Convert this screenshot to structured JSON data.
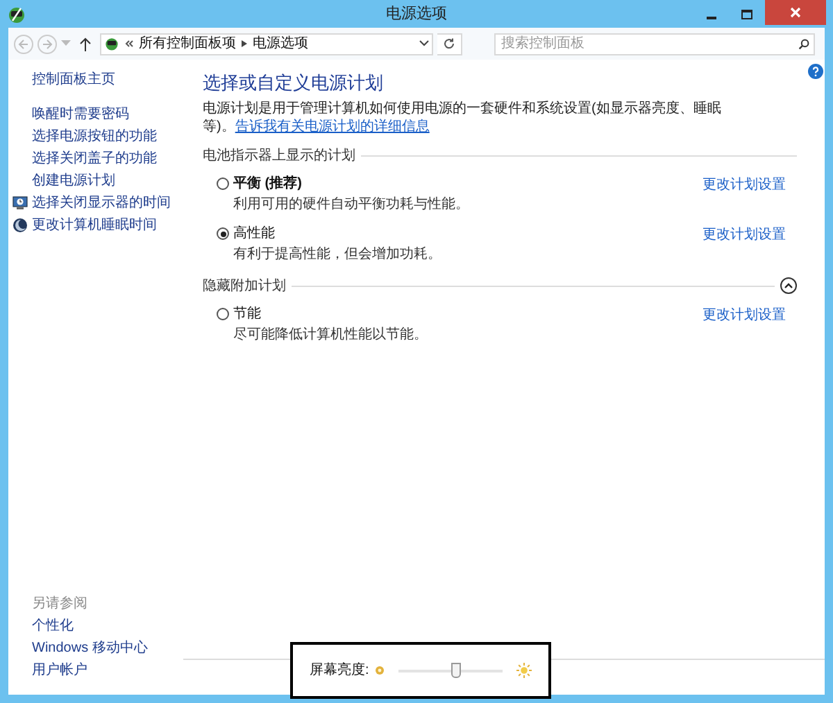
{
  "window": {
    "title": "电源选项"
  },
  "nav": {
    "back_disabled": true,
    "forward_disabled": true,
    "breadcrumb": [
      "所有控制面板项",
      "电源选项"
    ],
    "search": {
      "placeholder": "搜索控制面板"
    }
  },
  "sidebar": {
    "home": "控制面板主页",
    "tasks": [
      {
        "label": "唤醒时需要密码",
        "kind": "plain"
      },
      {
        "label": "选择电源按钮的功能",
        "kind": "plain"
      },
      {
        "label": "选择关闭盖子的功能",
        "kind": "plain"
      },
      {
        "label": "创建电源计划",
        "kind": "plain"
      },
      {
        "label": "选择关闭显示器的时间",
        "kind": "display"
      },
      {
        "label": "更改计算机睡眠时间",
        "kind": "sleep"
      }
    ],
    "see_also": {
      "heading": "另请参阅",
      "items": [
        "个性化",
        "Windows 移动中心",
        "用户帐户"
      ]
    }
  },
  "main": {
    "title": "选择或自定义电源计划",
    "description": "电源计划是用于管理计算机如何使用电源的一套硬件和系统设置(如显示器亮度、睡眠等)。",
    "description_link": "告诉我有关电源计划的详细信息",
    "sections": [
      {
        "heading": "电池指示器上显示的计划",
        "plans": [
          {
            "name": "平衡 (推荐)",
            "emphasized": true,
            "description": "利用可用的硬件自动平衡功耗与性能。",
            "selected": false,
            "link": "更改计划设置"
          },
          {
            "name": "高性能",
            "emphasized": false,
            "description": "有利于提高性能，但会增加功耗。",
            "selected": true,
            "link": "更改计划设置"
          }
        ]
      },
      {
        "heading": "隐藏附加计划",
        "expanded": true,
        "plans": [
          {
            "name": "节能",
            "emphasized": false,
            "description": "尽可能降低计算机性能以节能。",
            "selected": false,
            "link": "更改计划设置"
          }
        ]
      }
    ]
  },
  "brightness": {
    "label": "屏幕亮度:",
    "level": 0.55
  }
}
